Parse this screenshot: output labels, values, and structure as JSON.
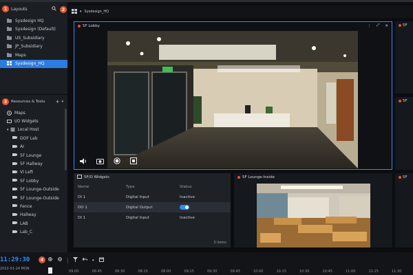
{
  "layouts_panel": {
    "title": "Layouts",
    "badge": "1",
    "items": [
      {
        "label": "Sysdesign HQ"
      },
      {
        "label": "Sysdesign (Default)"
      },
      {
        "label": "US_Subsidiary"
      },
      {
        "label": "JP_Subsidiary"
      },
      {
        "label": "Maps"
      },
      {
        "label": "Sysdesign_HQ",
        "selected": true
      }
    ]
  },
  "second_badge": "2",
  "resources_panel": {
    "title": "Resources & Tools",
    "badge": "3",
    "items": [
      {
        "label": "Maps",
        "indent": 0
      },
      {
        "label": "I/O Widgets",
        "indent": 0
      },
      {
        "label": "Local Host",
        "indent": 0
      },
      {
        "label": "DOF Lab",
        "indent": 1
      },
      {
        "label": "AI",
        "indent": 1
      },
      {
        "label": "5F Lounge",
        "indent": 1
      },
      {
        "label": "5F Hallway",
        "indent": 1
      },
      {
        "label": "VI Left",
        "indent": 1
      },
      {
        "label": "5F Lobby",
        "indent": 1
      },
      {
        "label": "5F Lounge-Outside",
        "indent": 1
      },
      {
        "label": "5F Lounge-Outside",
        "indent": 1
      },
      {
        "label": "Fence",
        "indent": 1
      },
      {
        "label": "Hallway",
        "indent": 1
      },
      {
        "label": "LAB",
        "indent": 1
      },
      {
        "label": "Lab_C",
        "indent": 1
      }
    ]
  },
  "layout_tab": {
    "label": "Sysdesign_HQ"
  },
  "main_camera": {
    "title": "5F Lobby"
  },
  "right_cam1": {
    "title": "5F"
  },
  "right_cam2": {
    "title": "5F"
  },
  "right_cam3": {
    "title": "5F"
  },
  "io_widget": {
    "title": "5F/O Widgets",
    "columns": [
      "Name",
      "Type",
      "Status"
    ],
    "rows": [
      {
        "name": "DI 1",
        "type": "Digital Input",
        "status": "Inactive"
      },
      {
        "name": "DO 1",
        "type": "Digital Output",
        "status": "",
        "toggle": true
      },
      {
        "name": "DI 1",
        "type": "Digital Input",
        "status": "Inactive"
      }
    ],
    "footer": "3 items"
  },
  "lounge_cam": {
    "title": "5F Lounge-Inside"
  },
  "bottom": {
    "time": "11:29:30",
    "badge": "4",
    "date": "2022-01-24 MON",
    "ticks": [
      "09:00",
      "08:45",
      "08:30",
      "08:15",
      "08:00",
      "09:15",
      "09:30",
      "09:45",
      "10:00",
      "10:15",
      "10:30",
      "10:45",
      "11:00",
      "11:15",
      "11:30"
    ]
  },
  "colors": {
    "accent": "#2f8cff",
    "badge": "#e8552a",
    "panel": "#1b1e23"
  }
}
